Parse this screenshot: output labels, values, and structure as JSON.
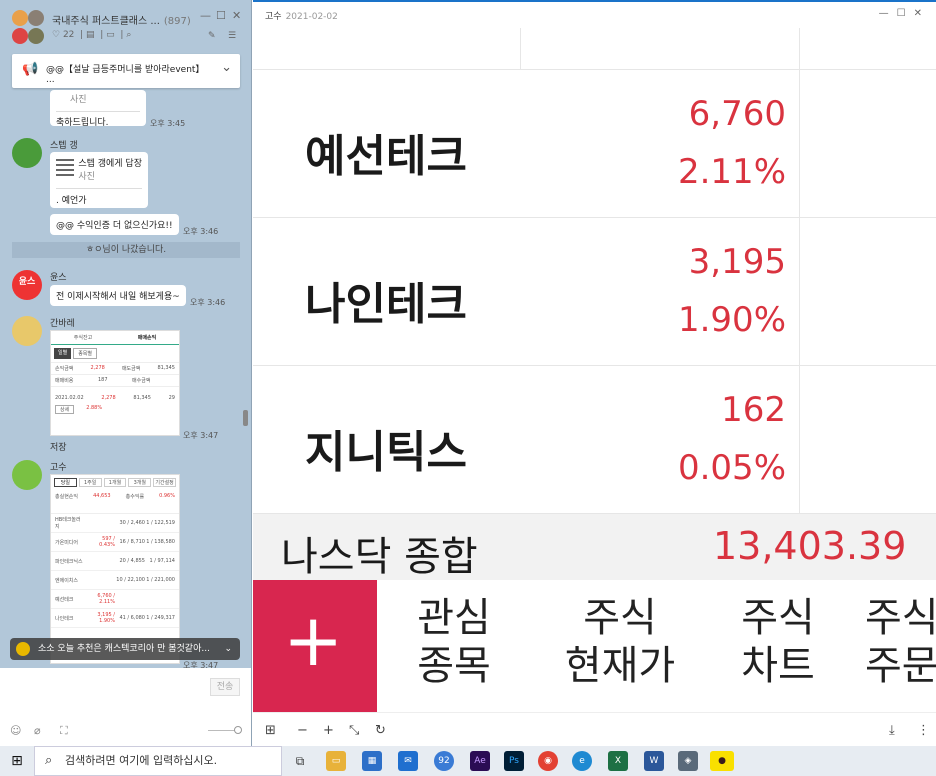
{
  "chat": {
    "title": "국내주식 퍼스트클래스 ...",
    "member_count": "(897)",
    "likes": "22",
    "notice": "@@【설날 급등주머니를 받아라event】",
    "notice_sub": "...",
    "messages": [
      {
        "text": "사진",
        "time": ""
      },
      {
        "text": "축하드립니다.",
        "time": "오후 3:45"
      },
      {
        "nick": "스텝 갱",
        "reply_to": "스텝 갱에게 답장",
        "reply_type": "사진",
        "text": ". 예언가"
      },
      {
        "text": "@@ 수익인증 더 없으신가요!!",
        "time": "오후 3:46"
      },
      {
        "nick": "윤스",
        "text": "전 이제시작해서 내일 해보게용~",
        "time": "오후 3:46"
      },
      {
        "nick": "간바레",
        "time": "오후 3:47",
        "caption": "저장"
      },
      {
        "nick": "고수",
        "time": "오후 3:47"
      }
    ],
    "system": "ㅎㅇ님이 나갔습니다.",
    "toast": "소소 오늘 추천은 캐스텍코리아 만 봄것같아...",
    "send": "전송",
    "avatar_yoon": "윤스"
  },
  "card1": {
    "tabs": [
      "주식잔고",
      "매매손익"
    ],
    "btns": [
      "일별",
      "종목별"
    ],
    "rows": [
      [
        "손익금액",
        "2,278",
        "매도금액",
        "81,345"
      ],
      [
        "매매비용",
        "187",
        "매수금액",
        ""
      ]
    ],
    "date": "2021.02.02",
    "vals": [
      "2,278",
      "81,345",
      "29"
    ],
    "pct": "2.88%",
    "detail": "상세"
  },
  "card2": {
    "tabs": [
      "당일",
      "1주일",
      "1개월",
      "3개월",
      "기간설정"
    ],
    "total_label": "총실현손익",
    "total": "44,653",
    "rate_label": "총수익률",
    "rate": "0.96%",
    "rows": [
      {
        "name": "HB테크놀러지",
        "a": "",
        "b": "30 / 2,460",
        "c": "1 / 122,519"
      },
      {
        "name": "가온미디어",
        "a": "597 / 0.43%",
        "b": "16 / 8,710",
        "c": "1 / 138,580"
      },
      {
        "name": "파인테크닉스",
        "a": "",
        "b": "20 / 4,855",
        "c": "1 / 97,114"
      },
      {
        "name": "엔에이치스",
        "a": "",
        "b": "10 / 22,100",
        "c": "1 / 221,000"
      },
      {
        "name": "예선테크",
        "a": "6,760 / 2.11%",
        "b": "",
        "c": ""
      },
      {
        "name": "나인테크",
        "a": "3,195 / 1.90%",
        "b": "41 / 6,080",
        "c": "1 / 249,317"
      }
    ]
  },
  "viewer": {
    "title": "고수",
    "date": "2021-02-02",
    "stocks": [
      {
        "name": "예선테크",
        "price": "6,760",
        "pct": "2.11%"
      },
      {
        "name": "나인테크",
        "price": "3,195",
        "pct": "1.90%"
      },
      {
        "name": "지니틱스",
        "price": "162",
        "pct": "0.05%"
      }
    ],
    "index_name": "나스닥 종합",
    "index_value": "13,403.39",
    "menu": [
      {
        "l1": "관심",
        "l2": "종목"
      },
      {
        "l1": "주식",
        "l2": "현재가"
      },
      {
        "l1": "주식",
        "l2": "차트"
      },
      {
        "l1": "주식",
        "l2": "주문"
      }
    ]
  },
  "taskbar": {
    "search_placeholder": "검색하려면 여기에 입력하십시오.",
    "badge": "92"
  },
  "colors": {
    "up": "#d9333f",
    "plus": "#d8264f",
    "chat_bg": "#b2c7d9"
  }
}
